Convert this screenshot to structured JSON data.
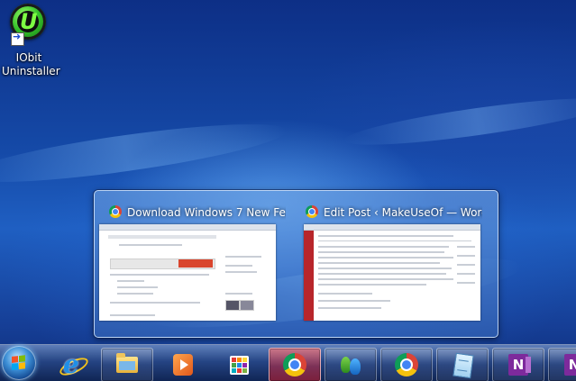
{
  "desktop": {
    "icons": [
      {
        "label": "IObit Uninstaller",
        "icon": "iobit-uninstaller-icon"
      }
    ]
  },
  "preview": {
    "thumbnails": [
      {
        "title": "Download Windows 7 New Feat...",
        "icon": "chrome-icon"
      },
      {
        "title": "Edit Post ‹ MakeUseOf — Word...",
        "icon": "chrome-icon"
      }
    ]
  },
  "taskbar": {
    "start": "windows-logo-icon",
    "buttons": [
      {
        "icon": "internet-explorer-icon"
      },
      {
        "icon": "windows-explorer-icon"
      },
      {
        "icon": "media-player-icon"
      },
      {
        "icon": "apps-grid-icon"
      },
      {
        "icon": "chrome-icon",
        "active": true
      },
      {
        "icon": "messenger-icon"
      },
      {
        "icon": "chrome-icon"
      },
      {
        "icon": "notepad-icon"
      },
      {
        "icon": "onenote-icon"
      },
      {
        "icon": "onenote-icon"
      }
    ]
  }
}
